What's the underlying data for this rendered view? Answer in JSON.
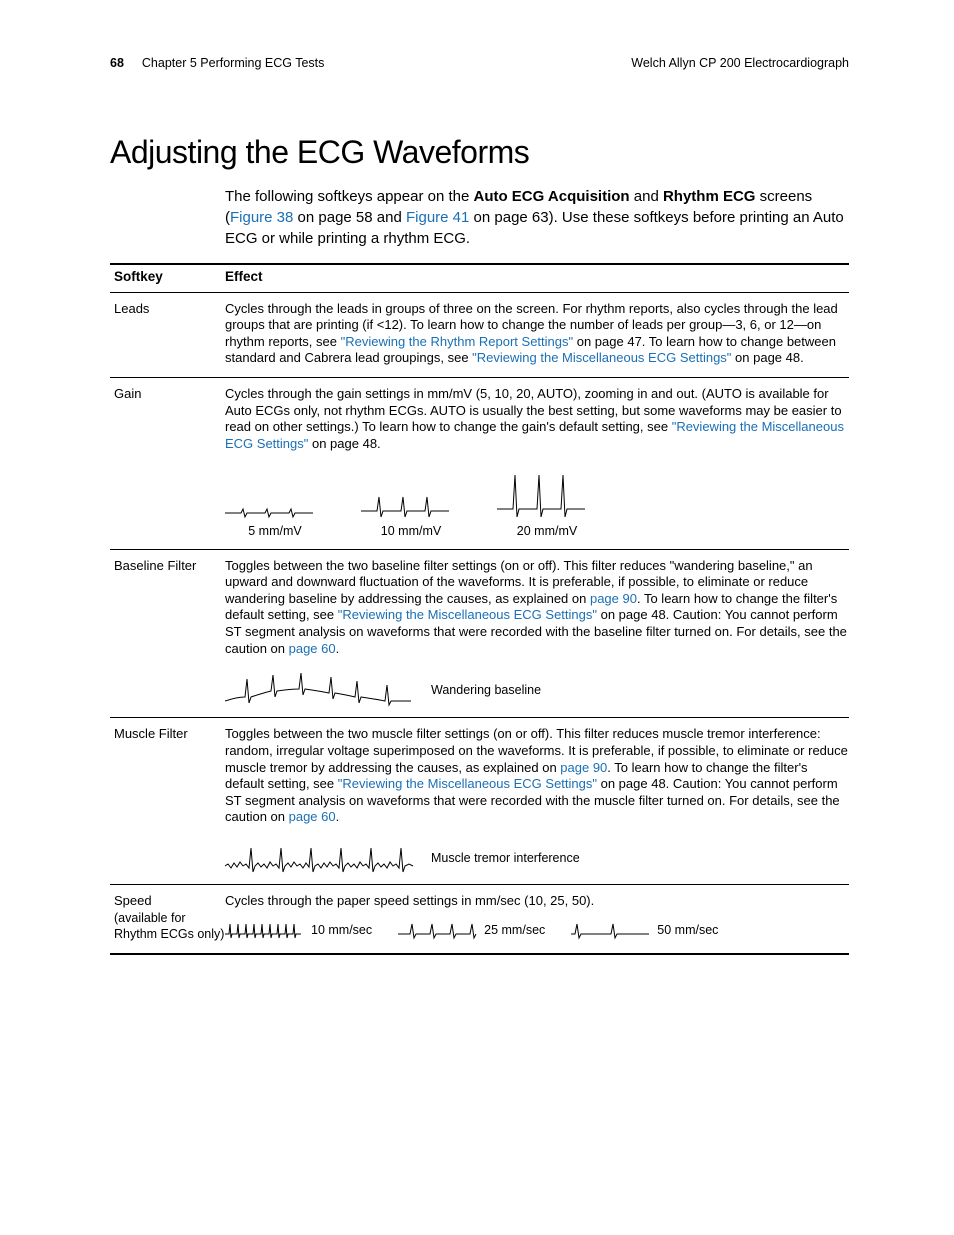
{
  "header": {
    "page_num": "68",
    "chapter": "Chapter 5   Performing ECG Tests",
    "product": "Welch Allyn CP 200 Electrocardiograph"
  },
  "title": "Adjusting the ECG Waveforms",
  "intro": {
    "pre": "The following softkeys appear on the ",
    "b1": "Auto ECG Acquisition",
    "mid1": " and ",
    "b2": "Rhythm ECG",
    "mid2": " screens (",
    "link1": "Figure 38",
    "mid3": " on page 58 and ",
    "link2": "Figure 41",
    "post": " on page 63). Use these softkeys before printing an Auto ECG or while printing a rhythm ECG."
  },
  "table": {
    "h1": "Softkey",
    "h2": "Effect",
    "rows": {
      "leads": {
        "name": "Leads",
        "text1": "Cycles through the leads in groups of three on the screen. For rhythm reports, also cycles through the lead groups that are printing (if <12). To learn how to change the number of leads per group—3, 6, or 12—on rhythm reports, see ",
        "link1": "\"Reviewing the Rhythm Report Settings\"",
        "text2": " on page 47. To learn how to change between standard and Cabrera lead groupings, see ",
        "link2": "\"Reviewing the Miscellaneous ECG Settings\"",
        "text3": " on page 48."
      },
      "gain": {
        "name": "Gain",
        "text1": "Cycles through the gain settings in mm/mV (5, 10, 20, AUTO), zooming in and out. (AUTO is available for Auto ECGs only, not rhythm ECGs. AUTO is usually the best setting, but some waveforms may be easier to read on other settings.) To learn how to change the gain's default setting, see ",
        "link1": "\"Reviewing the Miscellaneous ECG Settings\"",
        "text2": " on page 48.",
        "w1": "5 mm/mV",
        "w2": "10 mm/mV",
        "w3": "20 mm/mV"
      },
      "baseline": {
        "name": "Baseline Filter",
        "text1": "Toggles between the two baseline filter settings (on or off). This filter reduces \"wandering baseline,\" an upward and downward fluctuation of the waveforms. It is preferable, if possible, to eliminate or reduce wandering baseline by addressing the causes, as explained on ",
        "linkp1": "page 90",
        "text2": ". To learn how to change the filter's default setting, see ",
        "link1": "\"Reviewing the Miscellaneous ECG Settings\"",
        "text3": " on page 48. Caution: You cannot perform ST segment analysis on waveforms that were recorded with the baseline filter turned on. For details, see the caution on ",
        "linkp2": "page 60",
        "text4": ".",
        "wlabel": "Wandering baseline"
      },
      "muscle": {
        "name": "Muscle Filter",
        "text1": "Toggles between the two muscle filter settings (on or off). This filter reduces muscle tremor interference: random, irregular voltage superimposed on the waveforms. It is preferable, if possible, to eliminate or reduce muscle tremor by addressing the causes, as explained on ",
        "linkp1": "page 90",
        "text2": ". To learn how to change the filter's default setting, see ",
        "link1": "\"Reviewing the Miscellaneous ECG Settings\"",
        "text3": " on page 48. Caution: You cannot perform ST segment analysis on waveforms that were recorded with the muscle filter turned on. For details, see the caution on ",
        "linkp2": "page 60",
        "text4": ".",
        "wlabel": "Muscle tremor interference"
      },
      "speed": {
        "name": "Speed",
        "note": "(available for Rhythm ECGs only)",
        "text1": "Cycles through the paper speed settings in mm/sec (10, 25, 50).",
        "s1": "10 mm/sec",
        "s2": "25 mm/sec",
        "s3": "50 mm/sec"
      }
    }
  }
}
